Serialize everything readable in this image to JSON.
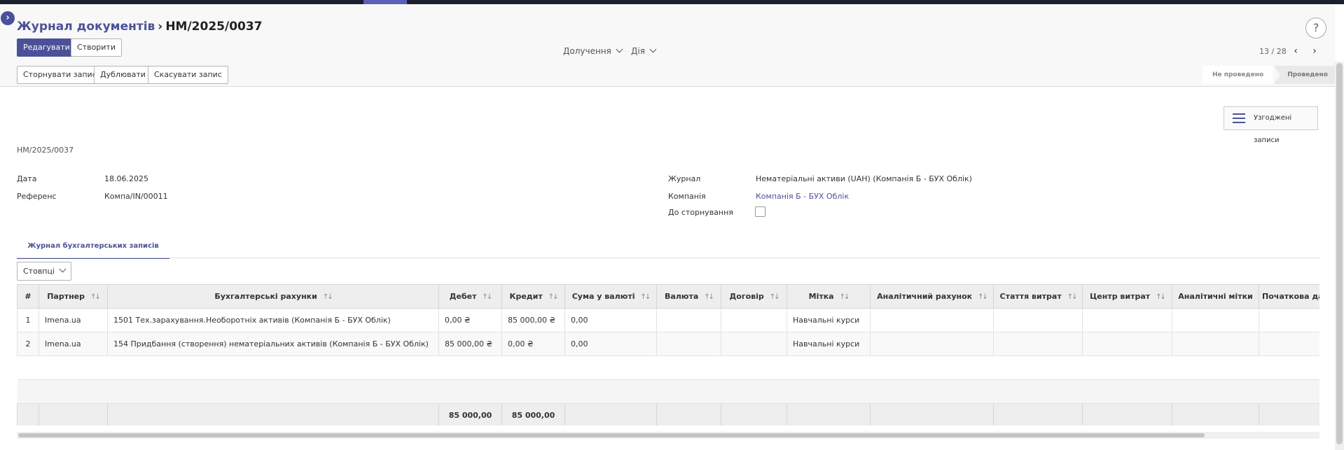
{
  "breadcrumb": {
    "parent": "Журнал документів",
    "current": "НМ/2025/0037"
  },
  "help": "?",
  "toolbar": {
    "edit": "Редагувати",
    "create": "Створити",
    "attachments": "Долучення",
    "action": "Дія",
    "pager": "13 / 28",
    "prev": "‹",
    "next": "›"
  },
  "header_buttons": {
    "reverse": "Сторнувати запис",
    "duplicate": "Дублювати",
    "cancel": "Скасувати запис"
  },
  "status": {
    "draft": "Не проведено",
    "posted": "Проведено",
    "current": "posted"
  },
  "smart_button": {
    "label": "Узгоджені записи",
    "icon": "list-icon"
  },
  "record": {
    "name": "НМ/2025/0037",
    "date_label": "Дата",
    "date": "18.06.2025",
    "ref_label": "Референс",
    "ref": "Компа/IN/00011",
    "journal_label": "Журнал",
    "journal": "Нематеріальні активи (UAH) (Компанія Б - БУХ Облік)",
    "company_label": "Компанія",
    "company": "Компанія Б - БУХ Облік",
    "reverse_label": "До сторнування",
    "reverse_checked": false
  },
  "tab": {
    "label": "Журнал бухгалтерських записів"
  },
  "columns_button": "Стовпці",
  "table": {
    "headers": [
      "#",
      "Партнер",
      "Бухгалтерські рахунки",
      "Дебет",
      "Кредит",
      "Сума у валюті",
      "Валюта",
      "Договір",
      "Мітка",
      "Аналітичний рахунок",
      "Стаття витрат",
      "Центр витрат",
      "Аналітичні мітки",
      "Початкова дата"
    ],
    "rows": [
      {
        "n": "1",
        "partner": "Imena.ua",
        "account": "1501 Тех.зарахування.Необоротніх активів (Компанія Б - БУХ Облік)",
        "debit": "0,00 ₴",
        "credit": "85 000,00 ₴",
        "amount_currency": "0,00",
        "currency": "",
        "contract": "",
        "label": "Навчальні курси",
        "analytic_account": "",
        "cost_item": "",
        "cost_center": "",
        "analytic_tags": "",
        "start_date": ""
      },
      {
        "n": "2",
        "partner": "Imena.ua",
        "account": "154 Придбання (створення) нематеріальних активів (Компанія Б - БУХ Облік)",
        "debit": "85 000,00 ₴",
        "credit": "0,00 ₴",
        "amount_currency": "0,00",
        "currency": "",
        "contract": "",
        "label": "Навчальні курси",
        "analytic_account": "",
        "cost_item": "",
        "cost_center": "",
        "analytic_tags": "",
        "start_date": ""
      }
    ],
    "totals": {
      "debit": "85 000,00",
      "credit": "85 000,00"
    }
  },
  "colors": {
    "accent": "#4b5198",
    "topbar": "#1c1f2e"
  }
}
